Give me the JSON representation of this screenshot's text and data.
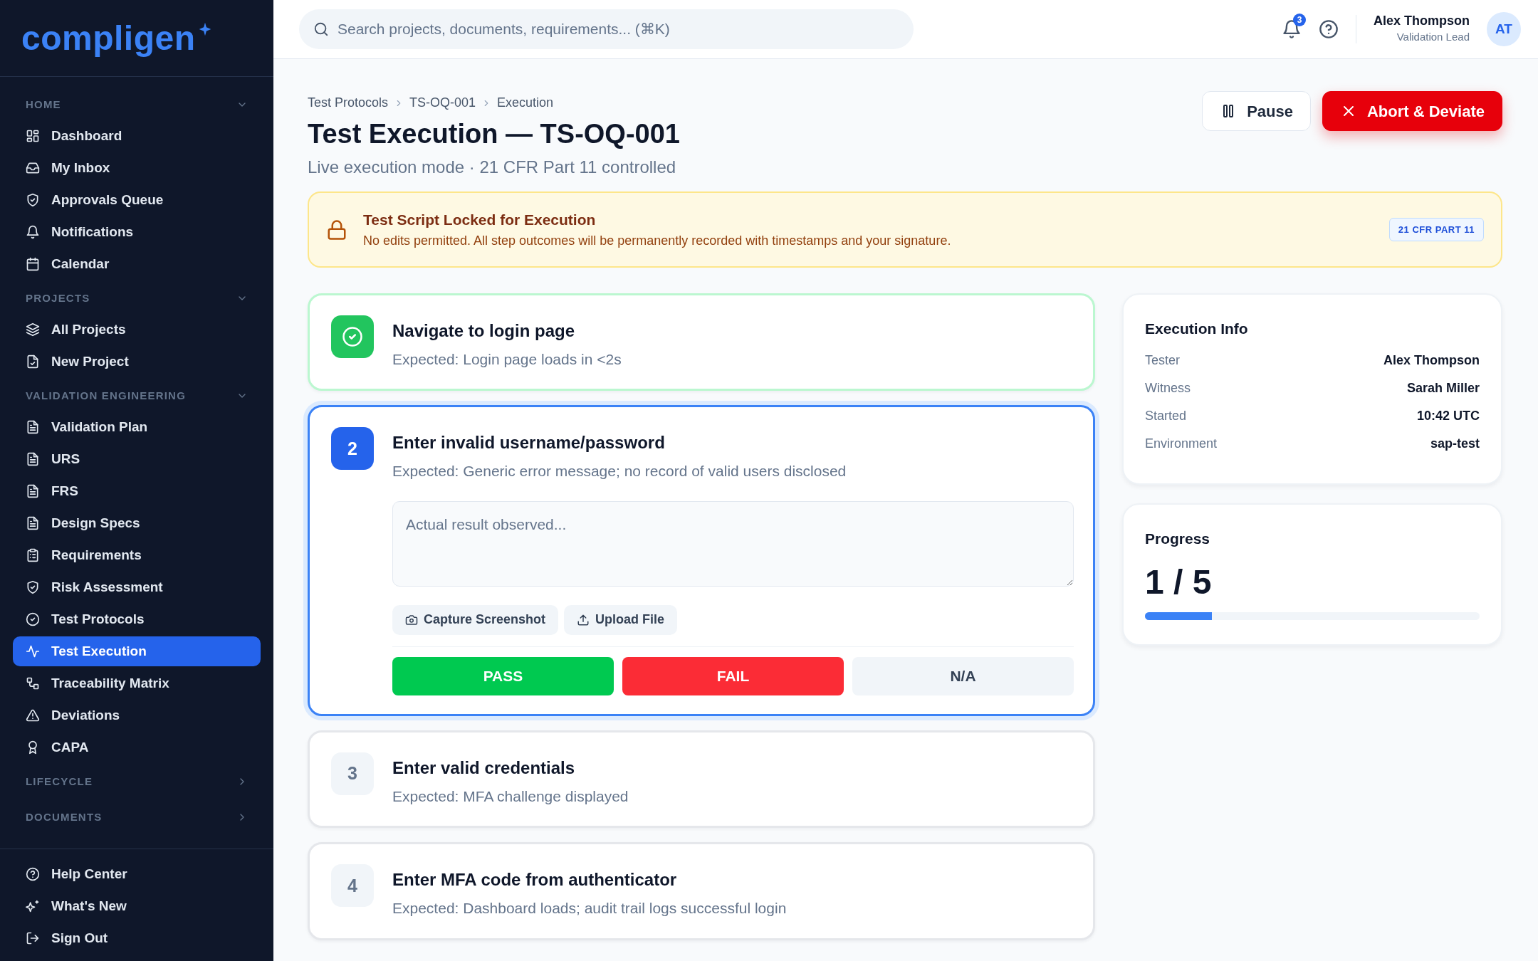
{
  "sidebar": {
    "logo": "compligen",
    "sections": [
      {
        "label": "HOME",
        "expanded": true,
        "items": [
          {
            "label": "Dashboard",
            "selected": false
          },
          {
            "label": "My Inbox",
            "selected": false
          },
          {
            "label": "Approvals Queue",
            "selected": false
          },
          {
            "label": "Notifications",
            "selected": false
          },
          {
            "label": "Calendar",
            "selected": false
          }
        ]
      },
      {
        "label": "PROJECTS",
        "expanded": true,
        "items": [
          {
            "label": "All Projects",
            "selected": false
          },
          {
            "label": "New Project",
            "selected": false
          }
        ]
      },
      {
        "label": "VALIDATION ENGINEERING",
        "expanded": true,
        "items": [
          {
            "label": "Validation Plan",
            "selected": false
          },
          {
            "label": "URS",
            "selected": false
          },
          {
            "label": "FRS",
            "selected": false
          },
          {
            "label": "Design Specs",
            "selected": false
          },
          {
            "label": "Requirements",
            "selected": false
          },
          {
            "label": "Risk Assessment",
            "selected": false
          },
          {
            "label": "Test Protocols",
            "selected": false
          },
          {
            "label": "Test Execution",
            "selected": true
          },
          {
            "label": "Traceability Matrix",
            "selected": false
          },
          {
            "label": "Deviations",
            "selected": false
          },
          {
            "label": "CAPA",
            "selected": false
          }
        ]
      },
      {
        "label": "LIFECYCLE",
        "expanded": false
      },
      {
        "label": "DOCUMENTS",
        "expanded": false
      }
    ],
    "footer_items": [
      {
        "label": "Help Center",
        "selected": false
      },
      {
        "label": "What's New",
        "selected": false
      },
      {
        "label": "Sign Out",
        "selected": false
      }
    ]
  },
  "header": {
    "search": {
      "placeholder": "Search projects, documents, requirements... (⌘K)"
    },
    "notification_count": "3",
    "user": {
      "name": "Alex Thompson",
      "role": "Validation Lead",
      "initials": "AT"
    }
  },
  "breadcrumbs": [
    "Test Protocols",
    "TS-OQ-001",
    "Execution"
  ],
  "title": "Test Execution — TS-OQ-001",
  "subtitle": "Live execution mode · 21 CFR Part 11 controlled",
  "actions": [
    {
      "label": "Pause",
      "kind": "secondary"
    },
    {
      "label": "Abort & Deviate",
      "kind": "danger"
    }
  ],
  "alert": {
    "title": "Test Script Locked for Execution",
    "message": "No edits permitted. All step outcomes will be permanently recorded with timestamps and your signature.",
    "badge": "21 CFR PART 11"
  },
  "steps": [
    {
      "completed": true,
      "current": false,
      "title": "Navigate to login page",
      "expected": "Expected: Login page loads in <2s"
    },
    {
      "completed": false,
      "current": true,
      "number": "2",
      "title": "Enter invalid username/password",
      "expected": "Expected: Generic error message; no record of valid users disclosed",
      "result": {
        "placeholder": "Actual result observed..."
      },
      "evidence_buttons": [
        "Capture Screenshot",
        "Upload File"
      ],
      "outcomes": [
        {
          "label": "PASS",
          "kind": "pass"
        },
        {
          "label": "FAIL",
          "kind": "fail"
        },
        {
          "label": "N/A",
          "kind": "na"
        }
      ]
    },
    {
      "completed": false,
      "current": false,
      "number": "3",
      "title": "Enter valid credentials",
      "expected": "Expected: MFA challenge displayed"
    },
    {
      "completed": false,
      "current": false,
      "number": "4",
      "title": "Enter MFA code from authenticator",
      "expected": "Expected: Dashboard loads; audit trail logs successful login"
    }
  ],
  "execution_info": {
    "title": "Execution Info",
    "rows": [
      {
        "label": "Tester",
        "value": "Alex Thompson"
      },
      {
        "label": "Witness",
        "value": "Sarah Miller"
      },
      {
        "label": "Started",
        "value": "10:42 UTC"
      },
      {
        "label": "Environment",
        "value": "sap-test"
      }
    ]
  },
  "progress": {
    "title": "Progress",
    "count": "1 / 5",
    "level": 0.2
  }
}
